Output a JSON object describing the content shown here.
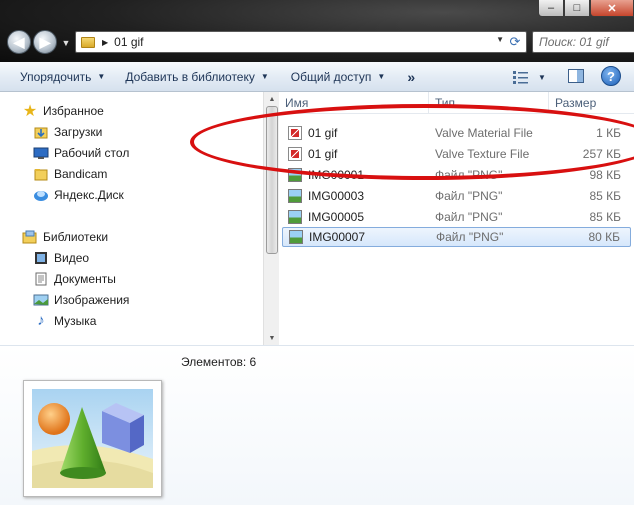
{
  "window": {
    "controls": {
      "minimize": "–",
      "maximize": "□",
      "close": "✕"
    }
  },
  "address": {
    "path": "01 gif",
    "search_placeholder": "Поиск: 01 gif"
  },
  "toolbar": {
    "organize": "Упорядочить",
    "add_to_library": "Добавить в библиотеку",
    "share": "Общий доступ",
    "more": "»"
  },
  "nav": {
    "favorites": {
      "label": "Избранное",
      "items": [
        {
          "label": "Загрузки",
          "icon": "downloads-folder-icon"
        },
        {
          "label": "Рабочий стол",
          "icon": "desktop-icon"
        },
        {
          "label": "Bandicam",
          "icon": "folder-icon"
        },
        {
          "label": "Яндекс.Диск",
          "icon": "yandex-disk-icon"
        }
      ]
    },
    "libraries": {
      "label": "Библиотеки",
      "items": [
        {
          "label": "Видео",
          "icon": "video-library-icon"
        },
        {
          "label": "Документы",
          "icon": "documents-library-icon"
        },
        {
          "label": "Изображения",
          "icon": "pictures-library-icon"
        },
        {
          "label": "Музыка",
          "icon": "music-library-icon"
        }
      ]
    }
  },
  "columns": {
    "name": "Имя",
    "type": "Тип",
    "size": "Размер"
  },
  "files": [
    {
      "name": "01 gif",
      "type": "Valve Material File",
      "size": "1 КБ",
      "icon": "vmt-file-icon"
    },
    {
      "name": "01 gif",
      "type": "Valve Texture File",
      "size": "257 КБ",
      "icon": "vtf-file-icon"
    },
    {
      "name": "IMG00001",
      "type": "Файл \"PNG\"",
      "size": "98 КБ",
      "icon": "png-file-icon"
    },
    {
      "name": "IMG00003",
      "type": "Файл \"PNG\"",
      "size": "85 КБ",
      "icon": "png-file-icon"
    },
    {
      "name": "IMG00005",
      "type": "Файл \"PNG\"",
      "size": "85 КБ",
      "icon": "png-file-icon"
    },
    {
      "name": "IMG00007",
      "type": "Файл \"PNG\"",
      "size": "80 КБ",
      "icon": "png-file-icon"
    }
  ],
  "selected_file_index": 5,
  "details": {
    "items_count": "Элементов: 6"
  },
  "colors": {
    "annotation": "#d81010",
    "selection": "#d6e7fb",
    "toolbar_text": "#1e3557"
  }
}
